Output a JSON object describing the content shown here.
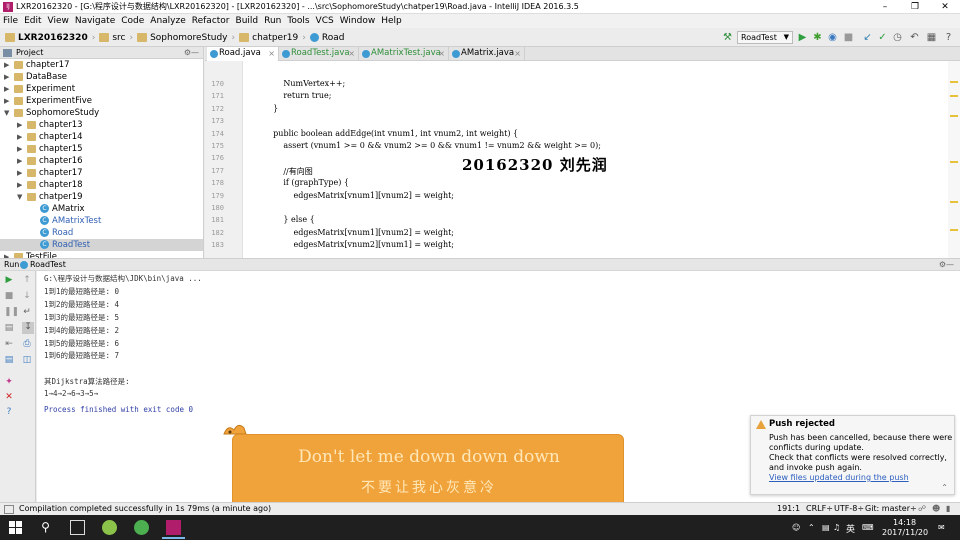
{
  "window": {
    "title": "LXR20162320 - [G:\\程序设计与数据结构\\LXR20162320] - [LXR20162320] - ...\\src\\SophomoreStudy\\chatper19\\Road.java - IntelliJ IDEA 2016.3.5",
    "app_icon": "IJ"
  },
  "menu": [
    "File",
    "Edit",
    "View",
    "Navigate",
    "Code",
    "Analyze",
    "Refactor",
    "Build",
    "Run",
    "Tools",
    "VCS",
    "Window",
    "Help"
  ],
  "breadcrumbs": [
    "LXR20162320",
    "src",
    "SophomoreStudy",
    "chatper19",
    "Road"
  ],
  "run_config": "RoadTest",
  "project_panel": {
    "title": "Project",
    "items": [
      {
        "label": "chapter17",
        "indent": 1,
        "type": "folder",
        "expanded": false
      },
      {
        "label": "DataBase",
        "indent": 1,
        "type": "folder",
        "expanded": false
      },
      {
        "label": "Experiment",
        "indent": 1,
        "type": "folder",
        "expanded": false
      },
      {
        "label": "ExperimentFive",
        "indent": 1,
        "type": "folder",
        "expanded": false
      },
      {
        "label": "SophomoreStudy",
        "indent": 1,
        "type": "folder",
        "expanded": true
      },
      {
        "label": "chapter13",
        "indent": 2,
        "type": "folder",
        "expanded": false
      },
      {
        "label": "chapter14",
        "indent": 2,
        "type": "folder",
        "expanded": false
      },
      {
        "label": "chapter15",
        "indent": 2,
        "type": "folder",
        "expanded": false
      },
      {
        "label": "chapter16",
        "indent": 2,
        "type": "folder",
        "expanded": false
      },
      {
        "label": "chapter17",
        "indent": 2,
        "type": "folder",
        "expanded": false
      },
      {
        "label": "chapter18",
        "indent": 2,
        "type": "folder",
        "expanded": false
      },
      {
        "label": "chatper19",
        "indent": 2,
        "type": "folder",
        "expanded": true
      },
      {
        "label": "AMatrix",
        "indent": 3,
        "type": "class"
      },
      {
        "label": "AMatrixTest",
        "indent": 3,
        "type": "class",
        "blue": true
      },
      {
        "label": "Road",
        "indent": 3,
        "type": "class",
        "blue": true
      },
      {
        "label": "RoadTest",
        "indent": 3,
        "type": "class",
        "blue": true,
        "selected": true
      },
      {
        "label": "TestFile",
        "indent": 1,
        "type": "folder",
        "expanded": false
      }
    ]
  },
  "tabs": [
    {
      "label": "Road.java",
      "active": true
    },
    {
      "label": "RoadTest.java",
      "active": false
    },
    {
      "label": "AMatrixTest.java",
      "active": false
    },
    {
      "label": "AMatrix.java",
      "active": false
    }
  ],
  "editor": {
    "line_numbers": [
      "170",
      "171",
      "172",
      "173",
      "174",
      "175",
      "176",
      "177",
      "178",
      "179",
      "180",
      "181",
      "182",
      "183"
    ],
    "lines": [
      "        NumVertex++;",
      "        return true;",
      "    }",
      "",
      "    public boolean addEdge(int vnum1, int vnum2, int weight) {",
      "        assert (vnum1 >= 0 && vnum2 >= 0 && vnum1 != vnum2 && weight >= 0);",
      "",
      "        //有向图",
      "        if (graphType) {",
      "            edgesMatrix[vnum1][vnum2] = weight;",
      "",
      "        } else {",
      "            edgesMatrix[vnum1][vnum2] = weight;",
      "            edgesMatrix[vnum2][vnum1] = weight;"
    ],
    "watermark": "20162320 刘先润"
  },
  "run_panel": {
    "label": "Run",
    "tab": "RoadTest",
    "output": [
      "G:\\程序设计与数据结构\\JDK\\bin\\java ...",
      "1到1的最短路径是: 0",
      "1到2的最短路径是: 4",
      "1到3的最短路径是: 5",
      "1到4的最短路径是: 2",
      "1到5的最短路径是: 6",
      "1到6的最短路径是: 7",
      "",
      "其Dijkstra算法路径是:",
      "1→4→2→6→3→5→",
      "Process finished with exit code 0"
    ]
  },
  "banner": {
    "line1": "Don't let me down down down",
    "line2": "不要让我心灰意冷"
  },
  "notification": {
    "title": "Push rejected",
    "lines": [
      "Push has been cancelled, because there were",
      "conflicts during update.",
      "Check that conflicts were resolved correctly,",
      "and invoke push again."
    ],
    "link": "View files updated during the push"
  },
  "status_bar": {
    "message": "Compilation completed successfully in 1s 79ms (a minute ago)",
    "position": "191:1",
    "line_sep": "CRLF÷",
    "encoding": "UTF-8÷",
    "git": "Git: master÷"
  },
  "taskbar": {
    "time": "14:18",
    "date": "2017/11/20",
    "ime": "英"
  },
  "colors": {
    "banner": "#f1a33b",
    "accent": "#3e9ad3",
    "warning": "#e8a23b"
  }
}
